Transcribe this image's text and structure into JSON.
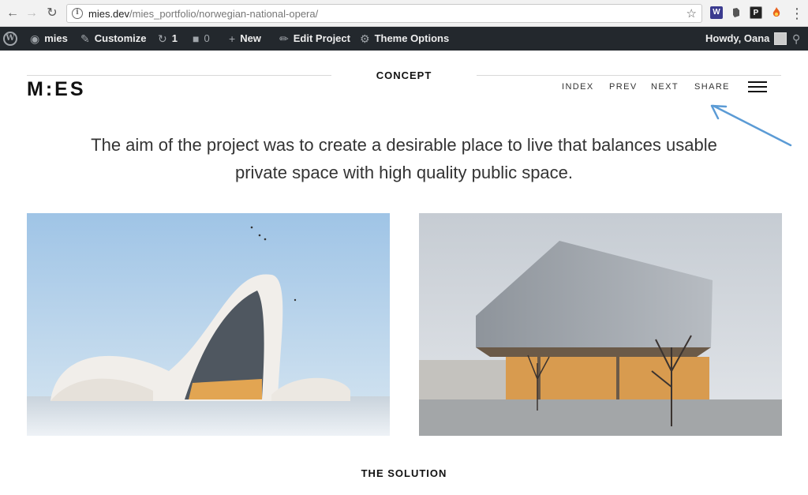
{
  "browser": {
    "url_domain": "mies.dev",
    "url_path": "/mies_portfolio/norwegian-national-opera/",
    "extensions": [
      {
        "name": "w-extension-icon",
        "label": "W",
        "color": "#3b3b8f"
      },
      {
        "name": "evernote-icon",
        "label": "",
        "color": "#555555"
      },
      {
        "name": "p-extension-icon",
        "label": "P",
        "color": "#222222"
      },
      {
        "name": "fire-icon",
        "label": "",
        "color": "#e8601c"
      }
    ]
  },
  "adminbar": {
    "site_name": "mies",
    "customize": "Customize",
    "updates_count": "1",
    "comments_count": "0",
    "new": "New",
    "edit_project": "Edit Project",
    "theme_options": "Theme Options",
    "howdy": "Howdy, Oana"
  },
  "site": {
    "logo": "M:ES",
    "section_title": "CONCEPT",
    "nav": {
      "index": "INDEX",
      "prev": "PREV",
      "next": "NEXT",
      "share": "SHARE"
    },
    "lead": "The aim of the project was to create a desirable place to live that balances usable private space with high quality public space.",
    "next_section": "THE SOLUTION"
  },
  "colors": {
    "annotation_arrow": "#5b9bd5",
    "admin_bar": "#23282d"
  }
}
